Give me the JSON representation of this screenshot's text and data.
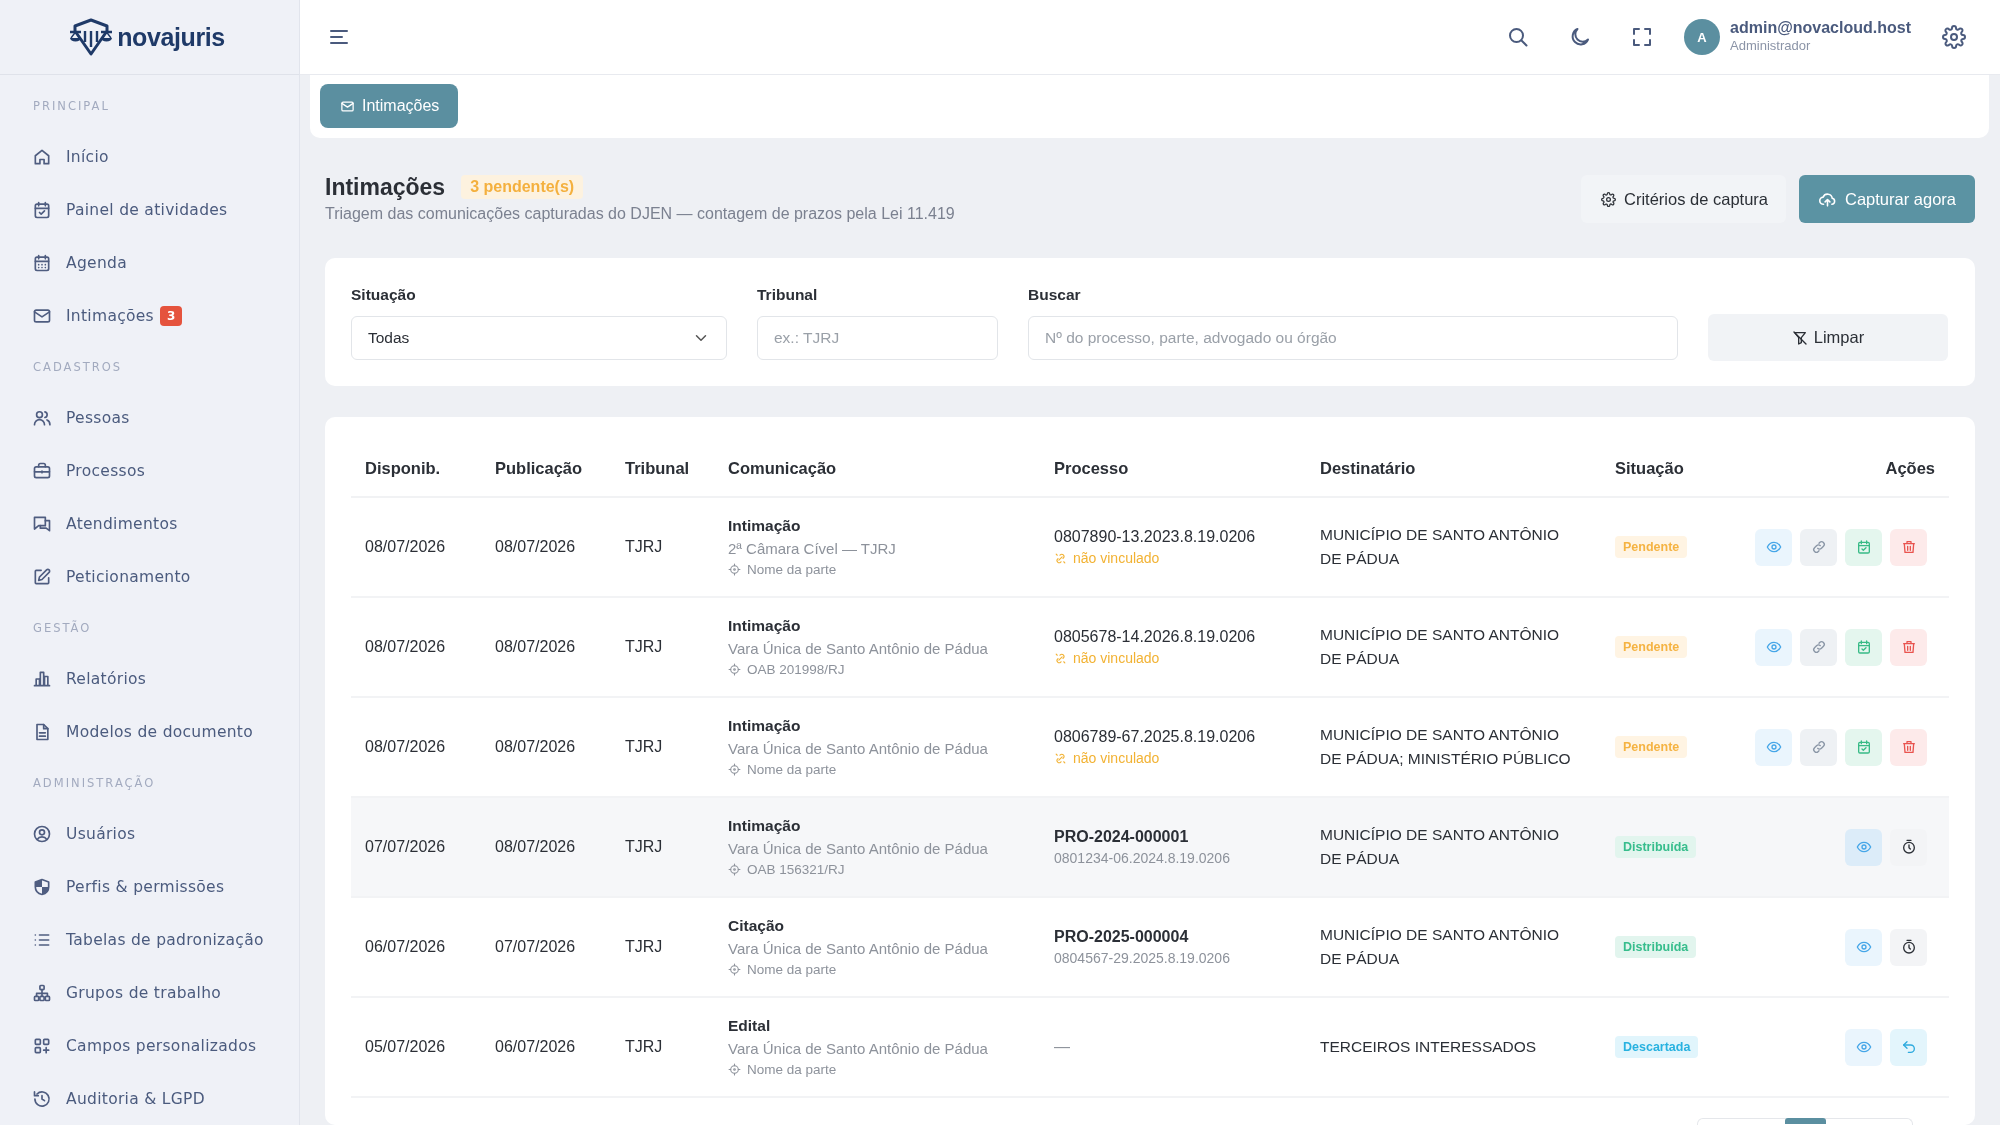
{
  "sidebar": {
    "logo": "novajuris",
    "sections": [
      {
        "title": "PRINCIPAL",
        "items": [
          {
            "label": "Início"
          },
          {
            "label": "Painel de atividades"
          },
          {
            "label": "Agenda"
          },
          {
            "label": "Intimações",
            "badge": "3"
          }
        ]
      },
      {
        "title": "CADASTROS",
        "items": [
          {
            "label": "Pessoas"
          },
          {
            "label": "Processos"
          },
          {
            "label": "Atendimentos"
          },
          {
            "label": "Peticionamento"
          }
        ]
      },
      {
        "title": "GESTÃO",
        "items": [
          {
            "label": "Relatórios"
          },
          {
            "label": "Modelos de documento"
          }
        ]
      },
      {
        "title": "ADMINISTRAÇÃO",
        "items": [
          {
            "label": "Usuários"
          },
          {
            "label": "Perfis & permissões"
          },
          {
            "label": "Tabelas de padronização"
          },
          {
            "label": "Grupos de trabalho"
          },
          {
            "label": "Campos personalizados"
          },
          {
            "label": "Auditoria & LGPD"
          }
        ]
      }
    ]
  },
  "topbar": {
    "user": {
      "initial": "A",
      "email": "admin@novacloud.host",
      "role": "Administrador"
    }
  },
  "breadcrumb": {
    "label": "Intimações"
  },
  "page_header": {
    "title": "Intimações",
    "badge": "3 pendente(s)",
    "subtitle": "Triagem das comunicações capturadas do DJEN — contagem de prazos pela Lei 11.419",
    "actions": [
      {
        "label": "Critérios de captura",
        "kind": "secondary"
      },
      {
        "label": "Capturar agora",
        "kind": "primary"
      }
    ]
  },
  "filters": {
    "status": {
      "label": "Situação",
      "value": "Todas"
    },
    "court": {
      "label": "Tribunal",
      "placeholder": "ex.: TJRJ"
    },
    "search": {
      "label": "Buscar",
      "placeholder": "Nº do processo, parte, advogado ou órgão"
    },
    "clear_button": "Limpar"
  },
  "table": {
    "columns": [
      "Disponib.",
      "Publicação",
      "Tribunal",
      "Comunicação",
      "Processo",
      "Destinatário",
      "Situação",
      "Ações"
    ],
    "rows": [
      {
        "available": "08/07/2026",
        "published": "08/07/2026",
        "court": "TJRJ",
        "communication": {
          "type": "Intimação",
          "origin": "2ª Câmara Cível — TJRJ",
          "reference": "Nome da parte"
        },
        "process": {
          "kind": "unlinked",
          "number": "0807890-13.2023.8.19.0206",
          "note": "não vinculado"
        },
        "recipient": "MUNICÍPIO DE SANTO ANTÔNIO DE PÁDUA",
        "status": {
          "label": "Pendente",
          "kind": "pending"
        },
        "actions": [
          {
            "kind": "view"
          },
          {
            "kind": "link"
          },
          {
            "kind": "schedule"
          },
          {
            "kind": "delete"
          }
        ],
        "highlighted": false
      },
      {
        "available": "08/07/2026",
        "published": "08/07/2026",
        "court": "TJRJ",
        "communication": {
          "type": "Intimação",
          "origin": "Vara Única de Santo Antônio de Pádua",
          "reference": "OAB 201998/RJ"
        },
        "process": {
          "kind": "unlinked",
          "number": "0805678-14.2026.8.19.0206",
          "note": "não vinculado"
        },
        "recipient": "MUNICÍPIO DE SANTO ANTÔNIO DE PÁDUA",
        "status": {
          "label": "Pendente",
          "kind": "pending"
        },
        "actions": [
          {
            "kind": "view"
          },
          {
            "kind": "link"
          },
          {
            "kind": "schedule"
          },
          {
            "kind": "delete"
          }
        ],
        "highlighted": false
      },
      {
        "available": "08/07/2026",
        "published": "08/07/2026",
        "court": "TJRJ",
        "communication": {
          "type": "Intimação",
          "origin": "Vara Única de Santo Antônio de Pádua",
          "reference": "Nome da parte"
        },
        "process": {
          "kind": "unlinked",
          "number": "0806789-67.2025.8.19.0206",
          "note": "não vinculado"
        },
        "recipient": "MUNICÍPIO DE SANTO ANTÔNIO DE PÁDUA; MINISTÉRIO PÚBLICO",
        "status": {
          "label": "Pendente",
          "kind": "pending"
        },
        "actions": [
          {
            "kind": "view"
          },
          {
            "kind": "link"
          },
          {
            "kind": "schedule"
          },
          {
            "kind": "delete"
          }
        ],
        "highlighted": false
      },
      {
        "available": "07/07/2026",
        "published": "08/07/2026",
        "court": "TJRJ",
        "communication": {
          "type": "Intimação",
          "origin": "Vara Única de Santo Antônio de Pádua",
          "reference": "OAB 156321/RJ"
        },
        "process": {
          "kind": "linked",
          "code": "PRO-2024-000001",
          "number": "0801234-06.2024.8.19.0206"
        },
        "recipient": "MUNICÍPIO DE SANTO ANTÔNIO DE PÁDUA",
        "status": {
          "label": "Distribuída",
          "kind": "distributed"
        },
        "actions": [
          {
            "kind": "view"
          },
          {
            "kind": "timer"
          }
        ],
        "highlighted": true
      },
      {
        "available": "06/07/2026",
        "published": "07/07/2026",
        "court": "TJRJ",
        "communication": {
          "type": "Citação",
          "origin": "Vara Única de Santo Antônio de Pádua",
          "reference": "Nome da parte"
        },
        "process": {
          "kind": "linked",
          "code": "PRO-2025-000004",
          "number": "0804567-29.2025.8.19.0206"
        },
        "recipient": "MUNICÍPIO DE SANTO ANTÔNIO DE PÁDUA",
        "status": {
          "label": "Distribuída",
          "kind": "distributed"
        },
        "actions": [
          {
            "kind": "view"
          },
          {
            "kind": "timer"
          }
        ],
        "highlighted": false
      },
      {
        "available": "05/07/2026",
        "published": "06/07/2026",
        "court": "TJRJ",
        "communication": {
          "type": "Edital",
          "origin": "Vara Única de Santo Antônio de Pádua",
          "reference": "Nome da parte"
        },
        "process": {
          "kind": "none",
          "text": "—"
        },
        "recipient": "TERCEIROS INTERESSADOS",
        "status": {
          "label": "Descartada",
          "kind": "discarded"
        },
        "actions": [
          {
            "kind": "view"
          },
          {
            "kind": "undo"
          }
        ],
        "highlighted": false
      }
    ]
  }
}
